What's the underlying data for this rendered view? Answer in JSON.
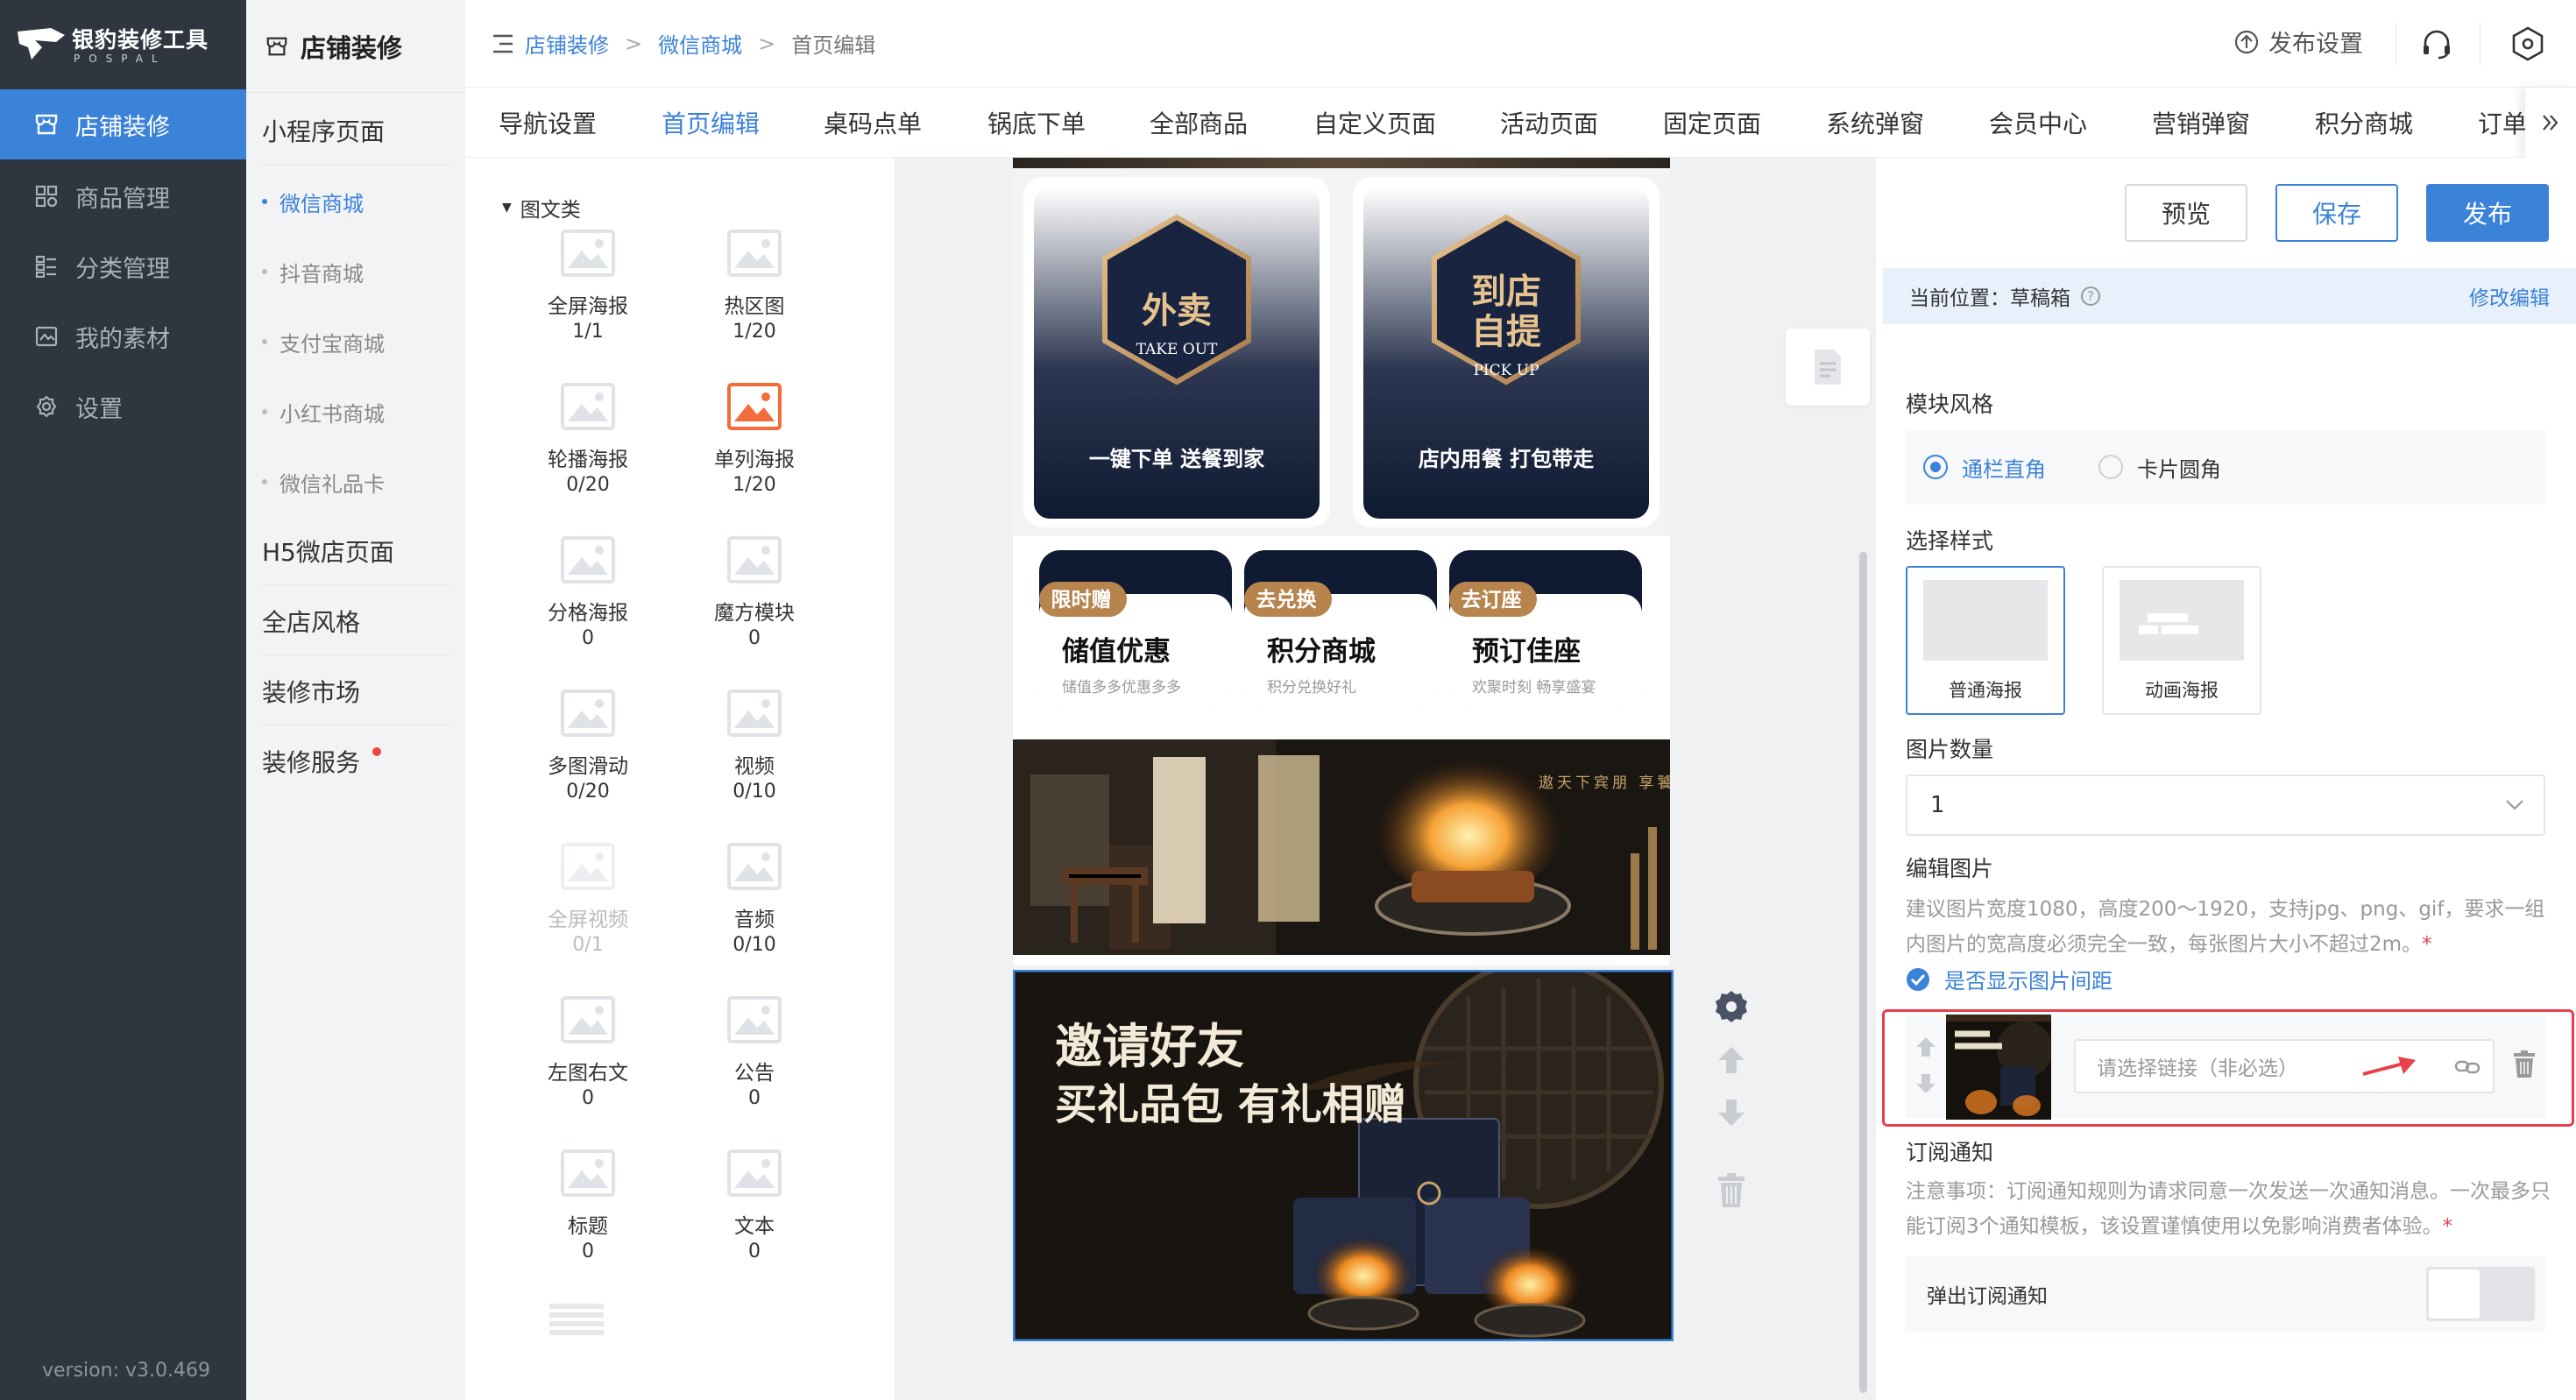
{
  "app": {
    "name": "银豹装修工具",
    "subname": "POSPAL",
    "version": "version: v3.0.469"
  },
  "nav": [
    {
      "label": "店铺装修",
      "icon": "store-icon",
      "active": true
    },
    {
      "label": "商品管理",
      "icon": "grid-icon"
    },
    {
      "label": "分类管理",
      "icon": "category-icon"
    },
    {
      "label": "我的素材",
      "icon": "image-icon"
    },
    {
      "label": "设置",
      "icon": "gear-icon"
    }
  ],
  "subnav": {
    "title": "店铺装修",
    "items": [
      {
        "label": "小程序页面",
        "level": 1
      },
      {
        "label": "微信商城",
        "level": 2,
        "active": true
      },
      {
        "label": "抖音商城",
        "level": 2
      },
      {
        "label": "支付宝商城",
        "level": 2
      },
      {
        "label": "小红书商城",
        "level": 2
      },
      {
        "label": "微信礼品卡",
        "level": 2
      },
      {
        "label": "H5微店页面",
        "level": 1
      },
      {
        "label": "全店风格",
        "level": 1
      },
      {
        "label": "装修市场",
        "level": 1
      },
      {
        "label": "装修服务",
        "level": 1,
        "badge": true
      }
    ]
  },
  "breadcrumb": [
    "店铺装修",
    "微信商城",
    "首页编辑"
  ],
  "top_actions": {
    "publish_settings": "发布设置"
  },
  "tabs": [
    "导航设置",
    "首页编辑",
    "桌码点单",
    "锅底下单",
    "全部商品",
    "自定义页面",
    "活动页面",
    "固定页面",
    "系统弹窗",
    "会员中心",
    "营销弹窗",
    "积分商城",
    "订单"
  ],
  "active_tab": "首页编辑",
  "palette": {
    "category": "图文类",
    "items": [
      {
        "name": "全屏海报",
        "count": "1/1"
      },
      {
        "name": "热区图",
        "count": "1/20"
      },
      {
        "name": "轮播海报",
        "count": "0/20"
      },
      {
        "name": "单列海报",
        "count": "1/20",
        "highlight": true
      },
      {
        "name": "分格海报",
        "count": "0"
      },
      {
        "name": "魔方模块",
        "count": "0"
      },
      {
        "name": "多图滑动",
        "count": "0/20"
      },
      {
        "name": "视频",
        "count": "0/10"
      },
      {
        "name": "全屏视频",
        "count": "0/1",
        "disabled": true
      },
      {
        "name": "音频",
        "count": "0/10"
      },
      {
        "name": "左图右文",
        "count": "0"
      },
      {
        "name": "公告",
        "count": "0"
      },
      {
        "name": "标题",
        "count": "0"
      },
      {
        "name": "文本",
        "count": "0"
      }
    ]
  },
  "preview": {
    "hex_cards": [
      {
        "t1": "外卖",
        "t2": "",
        "en": "TAKE OUT",
        "caption": "一键下单 送餐到家"
      },
      {
        "t1": "到店",
        "t2": "自提",
        "en": "PICK UP",
        "caption": "店内用餐 打包带走"
      }
    ],
    "small_cards": [
      {
        "tag": "限时赠",
        "title": "储值优惠",
        "sub": "储值多多优惠多多"
      },
      {
        "tag": "去兑换",
        "title": "积分商城",
        "sub": "积分兑换好礼"
      },
      {
        "tag": "去订座",
        "title": "预订佳座",
        "sub": "欢聚时刻 畅享盛宴"
      }
    ],
    "banner1_text": "遨天下宾朋 享饕餮盛宴",
    "banner2_line1": "邀请好友",
    "banner2_line2": "买礼品包 有礼相赠"
  },
  "panel": {
    "buttons": {
      "preview": "预览",
      "save": "保存",
      "publish": "发布"
    },
    "location_label": "当前位置：草稿箱",
    "modify": "修改编辑",
    "module_style": "模块风格",
    "style_options": [
      "通栏直角",
      "卡片圆角"
    ],
    "select_style": "选择样式",
    "style_cards": [
      "普通海报",
      "动画海报"
    ],
    "image_count_label": "图片数量",
    "image_count": "1",
    "edit_images": "编辑图片",
    "edit_hint": "建议图片宽度1080，高度200～1920，支持jpg、png、gif，要求一组内图片的宽高度必须完全一致，每张图片大小不超过2m。",
    "show_spacing": "是否显示图片间距",
    "link_placeholder": "请选择链接（非必选）",
    "subscribe_title": "订阅通知",
    "subscribe_hint": "注意事项：订阅通知规则为请求同意一次发送一次通知消息。一次最多只能订阅3个通知模板，该设置谨慎使用以免影响消费者体验。",
    "popup_label": "弹出订阅通知"
  },
  "colors": {
    "primary": "#3b82d9",
    "nav_bg": "#2f3640",
    "navy": "#0f1a33",
    "gold": "#c9a36a",
    "alert_red": "#e5414a"
  }
}
